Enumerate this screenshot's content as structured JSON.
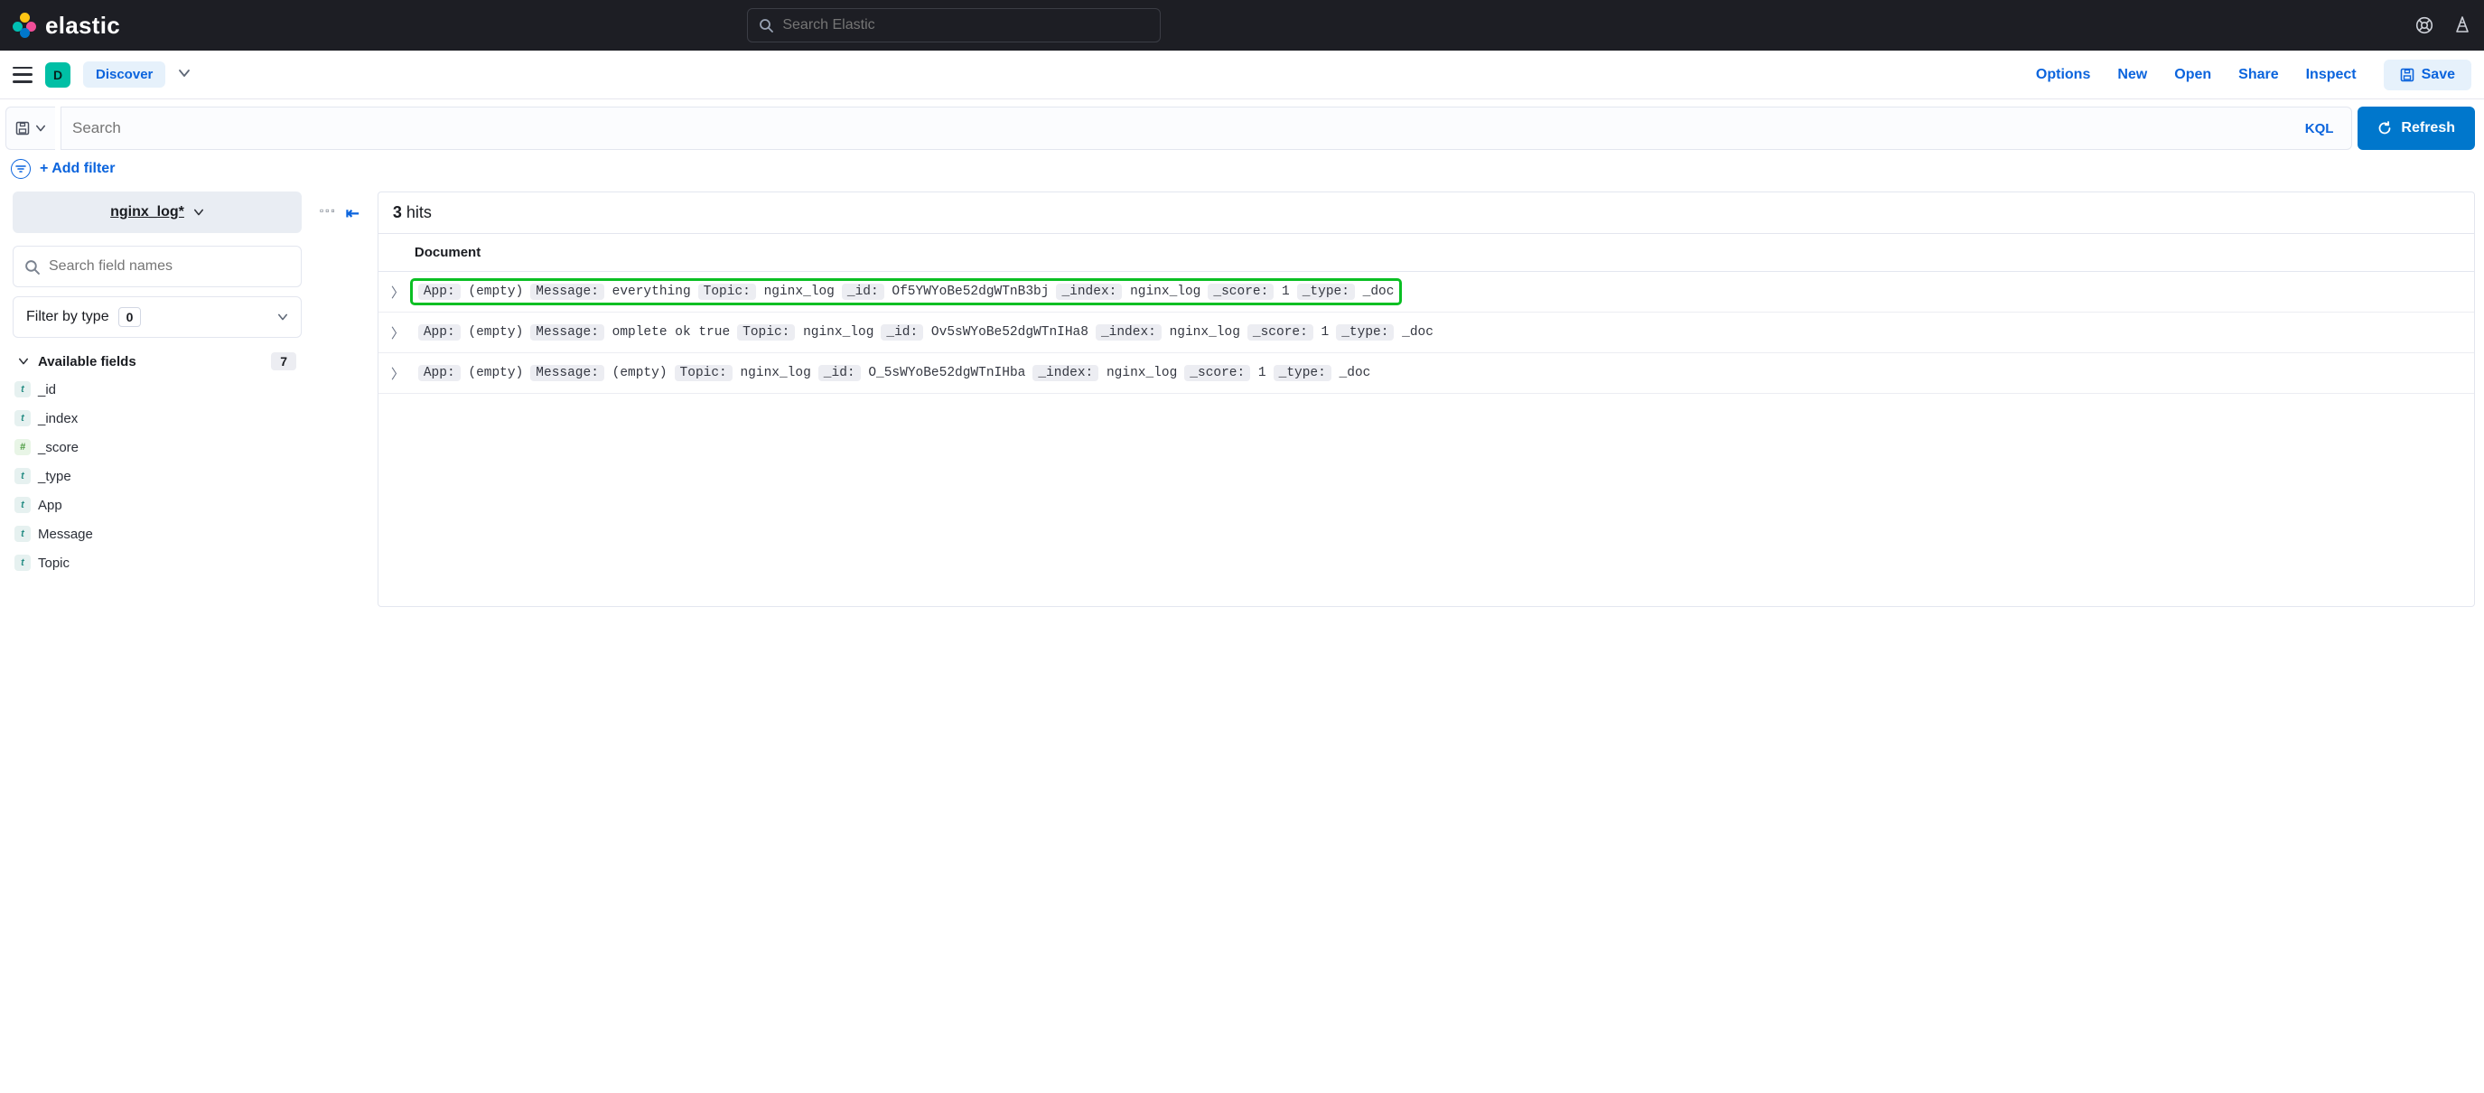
{
  "brand": {
    "name": "elastic"
  },
  "global_search": {
    "placeholder": "Search Elastic"
  },
  "sub_header": {
    "avatar_letter": "D",
    "app_name": "Discover",
    "actions": {
      "options": "Options",
      "new": "New",
      "open": "Open",
      "share": "Share",
      "inspect": "Inspect",
      "save": "Save"
    }
  },
  "query": {
    "placeholder": "Search",
    "lang": "KQL",
    "refresh": "Refresh"
  },
  "filters": {
    "add_filter": "+ Add filter"
  },
  "sidebar": {
    "index_pattern": "nginx_log*",
    "field_search_placeholder": "Search field names",
    "filter_type_label": "Filter by type",
    "filter_type_count": "0",
    "available_label": "Available fields",
    "available_count": "7",
    "fields": [
      {
        "type": "t",
        "name": "_id"
      },
      {
        "type": "t",
        "name": "_index"
      },
      {
        "type": "#",
        "name": "_score"
      },
      {
        "type": "t",
        "name": "_type"
      },
      {
        "type": "t",
        "name": "App"
      },
      {
        "type": "t",
        "name": "Message"
      },
      {
        "type": "t",
        "name": "Topic"
      }
    ]
  },
  "results": {
    "hits_count": "3",
    "hits_label": "hits",
    "doc_header": "Document",
    "docs": [
      {
        "highlight": true,
        "pairs": [
          [
            "App:",
            "(empty)"
          ],
          [
            "Message:",
            "everything"
          ],
          [
            "Topic:",
            "nginx_log"
          ],
          [
            "_id:",
            "Of5YWYoBe52dgWTnB3bj"
          ],
          [
            "_index:",
            "nginx_log"
          ],
          [
            "_score:",
            "1"
          ],
          [
            "_type:",
            "_doc"
          ]
        ]
      },
      {
        "highlight": false,
        "pairs": [
          [
            "App:",
            "(empty)"
          ],
          [
            "Message:",
            "omplete ok true"
          ],
          [
            "Topic:",
            "nginx_log"
          ],
          [
            "_id:",
            "Ov5sWYoBe52dgWTnIHa8"
          ],
          [
            "_index:",
            "nginx_log"
          ],
          [
            "_score:",
            "1"
          ],
          [
            "_type:",
            "_doc"
          ]
        ]
      },
      {
        "highlight": false,
        "pairs": [
          [
            "App:",
            "(empty)"
          ],
          [
            "Message:",
            "(empty)"
          ],
          [
            "Topic:",
            "nginx_log"
          ],
          [
            "_id:",
            "O_5sWYoBe52dgWTnIHba"
          ],
          [
            "_index:",
            "nginx_log"
          ],
          [
            "_score:",
            "1"
          ],
          [
            "_type:",
            "_doc"
          ]
        ]
      }
    ]
  }
}
